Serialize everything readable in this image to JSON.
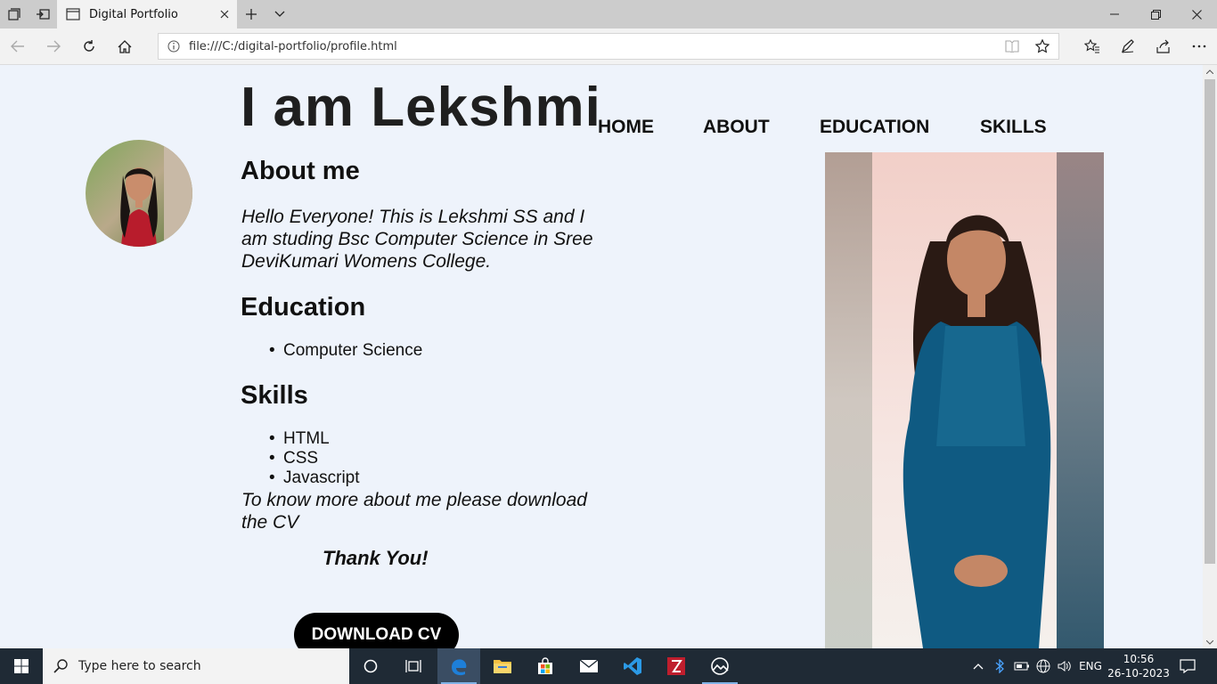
{
  "browser": {
    "tab_title": "Digital Portfolio",
    "address": "file:///C:/digital-portfolio/profile.html"
  },
  "page": {
    "title": "I am Lekshmi",
    "menu": [
      "HOME",
      "ABOUT",
      "EDUCATION",
      "SKILLS"
    ],
    "about_heading": "About me",
    "about_text": "Hello Everyone! This is Lekshmi SS and I am studing Bsc Computer Science in Sree DeviKumari Womens College.",
    "education_heading": "Education",
    "education_items": [
      "Computer Science"
    ],
    "skills_heading": "Skills",
    "skills_items": [
      "HTML",
      "CSS",
      "Javascript"
    ],
    "cv_text": "To know more about me please download the CV",
    "thanks": "Thank You!",
    "download_button": "DOWNLOAD CV"
  },
  "taskbar": {
    "search_placeholder": "Type here to search",
    "apps": [
      "task-view",
      "edge",
      "file-explorer",
      "microsoft-store",
      "mail",
      "vscode",
      "filezilla",
      "photos"
    ],
    "language": "ENG",
    "time": "10:56",
    "date": "26-10-2023"
  },
  "colors": {
    "page_background": "#eef3fb",
    "taskbar": "#1f2a35",
    "edge_blue": "#1e7fd8"
  }
}
